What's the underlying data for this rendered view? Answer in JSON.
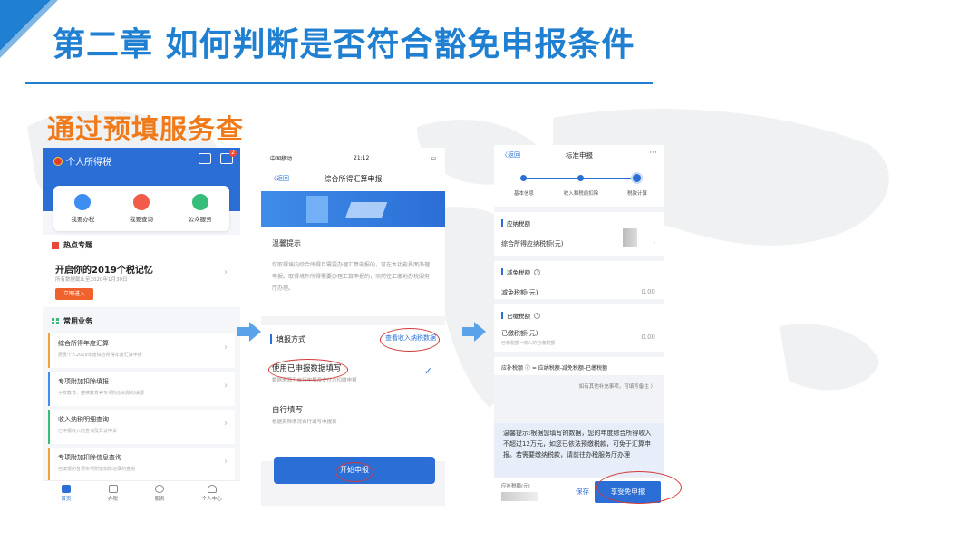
{
  "slide": {
    "title": "第二章 如何判断是否符合豁免申报条件",
    "subtitle": "通过预填服务查"
  },
  "colors": {
    "accent": "#1f7fd0",
    "subtitle": "#f07a1a",
    "app_blue": "#2b6fd6",
    "highlight_red": "#d23a3a"
  },
  "phone1": {
    "app_title": "个人所得税",
    "header_icons": [
      "scan-icon",
      "message-icon"
    ],
    "message_badge": "2",
    "quick": [
      "我要办税",
      "我要查询",
      "公众服务"
    ],
    "hot_section": "热点专题",
    "hot_title": "开启你的2019个税记忆",
    "hot_sub": "所有数据截止至2020年1月30日",
    "hot_button": "立即进入",
    "common_section": "常用业务",
    "items": [
      {
        "title": "综合所得年度汇算",
        "desc": "居民个人2019年度综合所得年度汇算申报"
      },
      {
        "title": "专项附加扣除填报",
        "desc": "子女教育、继续教育等专项附加扣除的填报"
      },
      {
        "title": "收入纳税明细查询",
        "desc": "已申报收入的查询及异议申诉"
      },
      {
        "title": "专项附加扣除信息查询",
        "desc": "已填报的各项专项附加扣除记录的查询"
      }
    ],
    "tabs": [
      "首页",
      "办税",
      "服务",
      "个人中心"
    ]
  },
  "phone2": {
    "carrier": "中国移动",
    "time": "21:12",
    "back": "〈返回",
    "nav_title": "综合所得汇算申报",
    "tips_title": "温馨提示",
    "tips_body": "仅取得境内综合所得且需要办理汇算申报的，可在本功能界面办理申报。取得境外所得需要办理汇算申报的，须前往汇缴地办税服务厅办理。",
    "method_title": "填报方式",
    "method_link": "查看收入纳税数据",
    "option1": "使用已申报数据填写",
    "option1_desc": "数据来源于自行申报及支付方扣缴申报",
    "option2": "自行填写",
    "option2_desc": "根据实际情况自行填写申报表",
    "start_button": "开始申报"
  },
  "phone3": {
    "back": "〈返回",
    "nav_title": "标准申报",
    "more": "···",
    "steps": [
      "基本信息",
      "收入和税前扣除",
      "税款计算"
    ],
    "sec1": "应纳税额",
    "sec1_row": "综合所得应纳税额(元)",
    "sec2": "减免税额",
    "sec2_row": "减免税额(元)",
    "sec2_val": "0.00",
    "sec3": "已缴税额",
    "sec3_row": "已缴税额(元)",
    "sec3_sub": "已缴税额=收入的已缴税额",
    "sec3_val": "0.00",
    "formula": "应补税额 ⓘ = 应纳税额-减免税额-已缴税额",
    "note": "如有其他补充事项，可填写备注 〉",
    "warm_tip": "温馨提示:根据您填写的数据，您的年度综合所得收入不超过12万元，如您已依法预缴税款，可免于汇算申报。若需要缴纳税款，请前往办税服务厅办理",
    "foot_label": "应补税额(元)",
    "save": "保存",
    "enjoy": "享受免申报"
  }
}
